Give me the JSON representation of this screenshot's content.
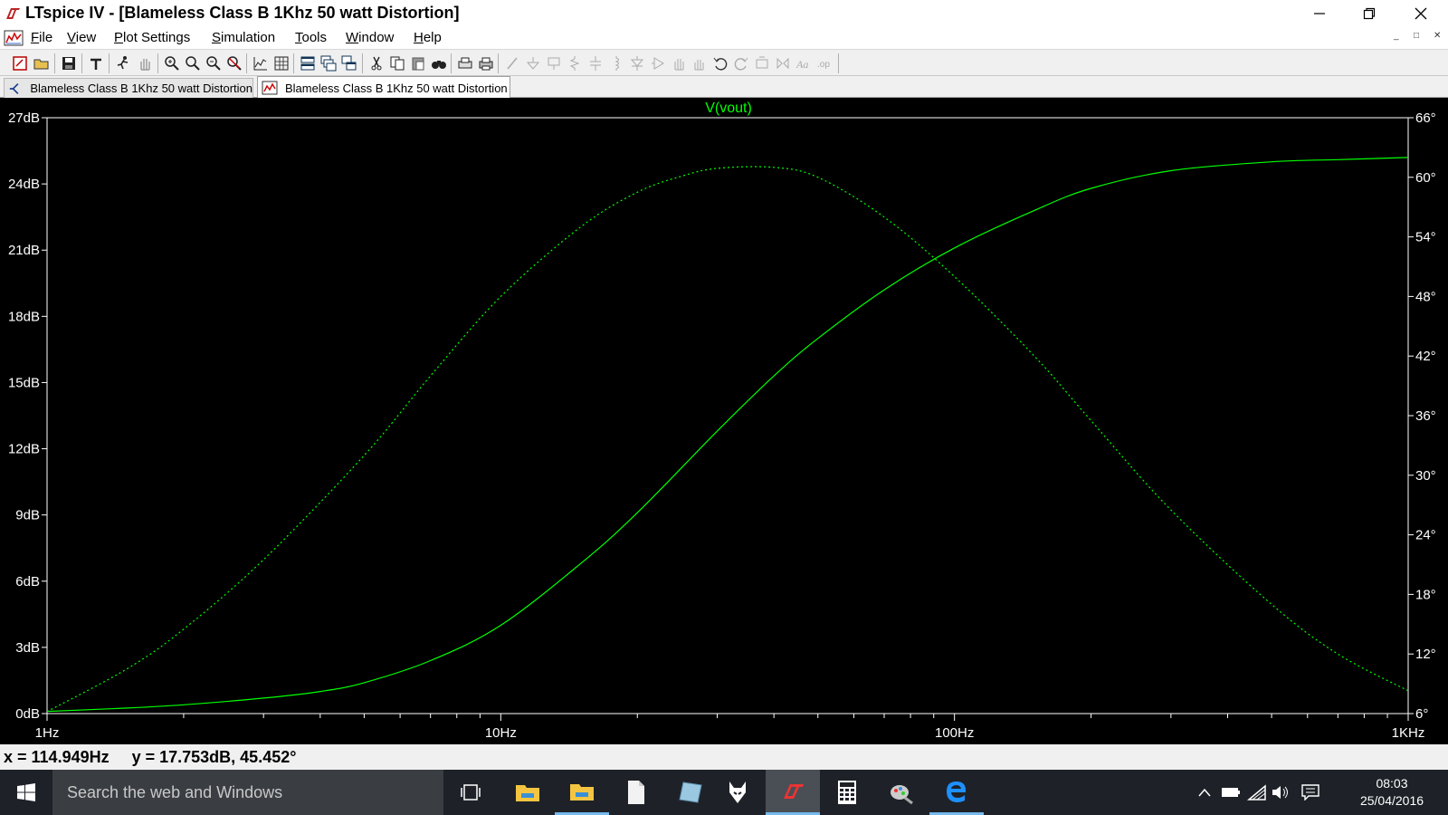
{
  "window": {
    "title": "LTspice IV - [Blameless Class B 1Khz 50 watt Distortion]",
    "logo_icon": "ltspice-logo-icon",
    "controls": [
      "minimize-icon",
      "restore-icon",
      "close-icon"
    ]
  },
  "menu": {
    "items": [
      {
        "label": "File",
        "accel": "F",
        "rest": "ile"
      },
      {
        "label": "View",
        "accel": "V",
        "rest": "iew"
      },
      {
        "label": "Plot Settings",
        "accel": "P",
        "rest": "lot Settings"
      },
      {
        "label": "Simulation",
        "accel": "S",
        "rest": "imulation"
      },
      {
        "label": "Tools",
        "accel": "T",
        "rest": "ools"
      },
      {
        "label": "Window",
        "accel": "W",
        "rest": "indow"
      },
      {
        "label": "Help",
        "accel": "H",
        "rest": "elp"
      }
    ],
    "mdi_controls": [
      "_",
      "□",
      "✕"
    ]
  },
  "toolbar": {
    "icons": [
      "new-schematic-icon",
      "open-icon",
      "save-icon",
      "control-panel-icon",
      "run-icon",
      "halt-icon",
      "zoom-in-icon",
      "zoom-out-icon",
      "zoom-fit-icon",
      "zoom-cancel-icon",
      "autorange-icon",
      "grid-icon",
      "tile-horizontal-icon",
      "cascade-icon",
      "tile-vertical-icon",
      "cut-icon",
      "copy-icon",
      "paste-icon",
      "find-icon",
      "print-preview-icon",
      "print-icon",
      "wire-icon",
      "ground-icon",
      "label-icon",
      "resistor-icon",
      "capacitor-icon",
      "inductor-icon",
      "diode-icon",
      "component-icon",
      "move-icon",
      "drag-icon",
      "undo-icon",
      "redo-icon",
      "rotate-icon",
      "mirror-icon",
      "text-icon",
      "spice-directive-icon"
    ]
  },
  "tabs": [
    {
      "label": "Blameless Class B 1Khz 50 watt Distortion",
      "icon": "schematic-icon",
      "active": false
    },
    {
      "label": "Blameless Class B 1Khz 50 watt Distortion",
      "icon": "waveform-icon",
      "active": true
    }
  ],
  "chart_data": {
    "type": "line",
    "title": "V(vout)",
    "xscale": "log",
    "xlim": [
      1,
      1000
    ],
    "x_ticks": [
      {
        "value": 1,
        "label": "1Hz"
      },
      {
        "value": 10,
        "label": "10Hz"
      },
      {
        "value": 100,
        "label": "100Hz"
      },
      {
        "value": 1000,
        "label": "1KHz"
      }
    ],
    "y_left": {
      "ylim": [
        0,
        27
      ],
      "ticks": [
        {
          "value": 0,
          "label": "0dB"
        },
        {
          "value": 3,
          "label": "3dB"
        },
        {
          "value": 6,
          "label": "6dB"
        },
        {
          "value": 9,
          "label": "9dB"
        },
        {
          "value": 12,
          "label": "12dB"
        },
        {
          "value": 15,
          "label": "15dB"
        },
        {
          "value": 18,
          "label": "18dB"
        },
        {
          "value": 21,
          "label": "21dB"
        },
        {
          "value": 24,
          "label": "24dB"
        },
        {
          "value": 27,
          "label": "27dB"
        }
      ]
    },
    "y_right": {
      "ylim": [
        6,
        66
      ],
      "ticks": [
        {
          "value": 6,
          "label": "6°"
        },
        {
          "value": 12,
          "label": "12°"
        },
        {
          "value": 18,
          "label": "18°"
        },
        {
          "value": 24,
          "label": "24°"
        },
        {
          "value": 30,
          "label": "30°"
        },
        {
          "value": 36,
          "label": "36°"
        },
        {
          "value": 42,
          "label": "42°"
        },
        {
          "value": 48,
          "label": "48°"
        },
        {
          "value": 54,
          "label": "54°"
        },
        {
          "value": 60,
          "label": "60°"
        },
        {
          "value": 66,
          "label": "66°"
        }
      ]
    },
    "series": [
      {
        "name": "V(vout)",
        "role": "magnitude",
        "axis": "left",
        "style": "solid",
        "color": "#00ff00",
        "x": [
          1,
          1.5,
          2,
          3,
          4,
          5,
          7,
          10,
          15,
          20,
          30,
          40,
          50,
          70,
          100,
          150,
          200,
          300,
          500,
          700,
          1000
        ],
        "y": [
          0.1,
          0.25,
          0.4,
          0.7,
          1.0,
          1.4,
          2.4,
          4.0,
          6.8,
          9.1,
          12.8,
          15.3,
          17.0,
          19.2,
          21.1,
          22.8,
          23.8,
          24.6,
          25.0,
          25.1,
          25.2
        ]
      },
      {
        "name": "V(vout)",
        "role": "phase",
        "axis": "right",
        "style": "dashed",
        "color": "#00ff00",
        "x": [
          1,
          1.5,
          2,
          3,
          5,
          7,
          10,
          15,
          20,
          25,
          30,
          40,
          50,
          70,
          100,
          150,
          200,
          300,
          500,
          700,
          1000
        ],
        "y": [
          6.2,
          10.5,
          14.5,
          21.5,
          32.0,
          40.0,
          48.0,
          55.0,
          58.5,
          60.1,
          60.9,
          61.0,
          60.0,
          56.0,
          50.0,
          42.0,
          35.5,
          26.5,
          17.0,
          12.0,
          8.3
        ]
      }
    ],
    "grid": false,
    "legend": "top-center"
  },
  "status": {
    "cursor": "x = 114.949Hz     y = 17.753dB, 45.452°"
  },
  "taskbar": {
    "search_placeholder": "Search the web and Windows",
    "apps": [
      "task-view-icon",
      "file-explorer-icon",
      "folder-icon",
      "document-icon",
      "app-icon",
      "firefox-icon",
      "ltspice-icon",
      "calculator-icon",
      "paint-icon",
      "edge-icon"
    ],
    "tray": [
      "chevron-up-icon",
      "battery-icon",
      "wifi-icon",
      "volume-icon",
      "notification-icon"
    ],
    "time": "08:03",
    "date": "25/04/2016"
  }
}
